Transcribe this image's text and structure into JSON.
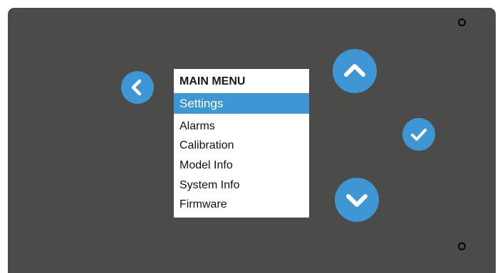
{
  "menu": {
    "title": "MAIN MENU",
    "selected_item": "Settings",
    "items": [
      "Alarms",
      "Calibration",
      "Model Info",
      "System Info",
      "Firmware"
    ]
  },
  "icons": {
    "back": "chevron-left-icon",
    "up": "chevron-up-icon",
    "down": "chevron-down-icon",
    "confirm": "checkmark-icon"
  },
  "colors": {
    "panel": "#4b4c4a",
    "accent": "#3e97d4",
    "menu_background": "#ffffff",
    "selected_text": "#ffffff",
    "menu_text": "#111111"
  }
}
